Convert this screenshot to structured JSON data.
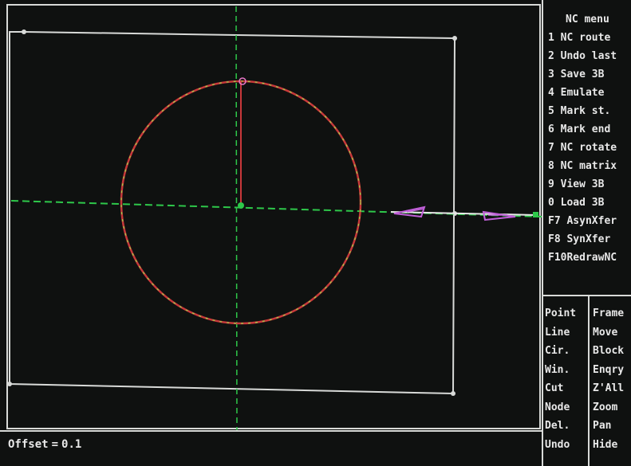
{
  "nc_menu": {
    "title": "NC menu",
    "items": [
      {
        "label": "1 NC route"
      },
      {
        "label": "2 Undo last"
      },
      {
        "label": "3 Save 3B"
      },
      {
        "label": "4 Emulate"
      },
      {
        "label": "5 Mark st."
      },
      {
        "label": "6 Mark end"
      },
      {
        "label": "7 NC rotate"
      },
      {
        "label": "8 NC matrix"
      },
      {
        "label": "9 View 3B"
      },
      {
        "label": "0 Load 3B"
      },
      {
        "label": "F7 AsynXfer"
      },
      {
        "label": "F8 SynXfer"
      },
      {
        "label": "F10RedrawNC"
      }
    ]
  },
  "commands": {
    "left": [
      "Point",
      "Line",
      "Cir.",
      "Win.",
      "Cut",
      "Node",
      "Del.",
      "Undo"
    ],
    "right": [
      "Frame",
      "Move",
      "Block",
      "Enqry",
      "Z'All",
      "Zoom",
      "Pan",
      "Hide"
    ]
  },
  "status": {
    "label": "Offset",
    "equals": "=",
    "value": "0.1"
  },
  "colors": {
    "frame": "#d8dad8",
    "axis": "#2ec84a",
    "circle_red": "#c8383a",
    "circle_green": "#9ad84a",
    "arrow": "#c060d8",
    "background": "#0f1110"
  },
  "icons": {
    "start-marker": "circle-dot",
    "direction": "arrow-left"
  }
}
